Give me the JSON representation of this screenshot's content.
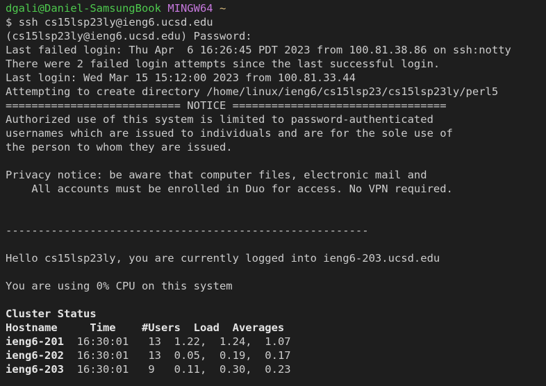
{
  "prompt": {
    "user_host": "dgali@Daniel-SamsungBook",
    "shell": "MINGW64",
    "path": "~",
    "symbol": "$",
    "command": "ssh cs15lsp23ly@ieng6.ucsd.edu"
  },
  "lines": [
    "(cs15lsp23ly@ieng6.ucsd.edu) Password:",
    "Last failed login: Thu Apr  6 16:26:45 PDT 2023 from 100.81.38.86 on ssh:notty",
    "There were 2 failed login attempts since the last successful login.",
    "Last login: Wed Mar 15 15:12:00 2023 from 100.81.33.44",
    "Attempting to create directory /home/linux/ieng6/cs15lsp23/cs15lsp23ly/perl5",
    "=========================== NOTICE =================================",
    "Authorized use of this system is limited to password-authenticated",
    "usernames which are issued to individuals and are for the sole use of",
    "the person to whom they are issued.",
    "",
    "Privacy notice: be aware that computer files, electronic mail and",
    "    All accounts must be enrolled in Duo for access. No VPN required.",
    "",
    "",
    "--------------------------------------------------------",
    "",
    "Hello cs15lsp23ly, you are currently logged into ieng6-203.ucsd.edu",
    "",
    "You are using 0% CPU on this system",
    ""
  ],
  "cluster": {
    "title": "Cluster Status",
    "header": "Hostname     Time    #Users  Load  Averages",
    "rows": [
      {
        "host": "ieng6-201",
        "rest": "  16:30:01   13  1.22,  1.24,  1.07"
      },
      {
        "host": "ieng6-202",
        "rest": "  16:30:01   13  0.05,  0.19,  0.17"
      },
      {
        "host": "ieng6-203",
        "rest": "  16:30:01   9   0.11,  0.30,  0.23"
      }
    ]
  },
  "colors": {
    "background": "#1e1e1e",
    "foreground": "#cccccc",
    "user_host": "#4ec94e",
    "shell": "#c678dd",
    "path": "#d7ba7d"
  }
}
